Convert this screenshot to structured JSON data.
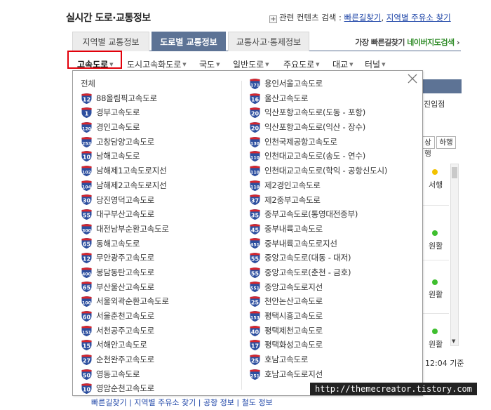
{
  "header": {
    "title": "실시간 도로·교통정보",
    "related_label": "관련 컨텐츠 검색 :",
    "related_links": [
      "빠른길찾기",
      "지역별 주유소 찾기"
    ],
    "related_sep": ","
  },
  "tabs": [
    {
      "label": "지역별 교통정보",
      "active": false
    },
    {
      "label": "도로별 교통정보",
      "active": true
    },
    {
      "label": "교통사고·통제정보",
      "active": false
    }
  ],
  "tab_right": {
    "prefix": "가장 빠른길찾기 ",
    "highlight": "네이버지도검색",
    "arrow": "›"
  },
  "subnav": [
    "고속도로",
    "도시고속화도로",
    "국도",
    "일반도로",
    "주요도로",
    "대교",
    "터널"
  ],
  "background": {
    "col_text": "진입점",
    "buttons": [
      "상행",
      "하행"
    ],
    "statuses": [
      "서행",
      "원활",
      "원활",
      "원활"
    ],
    "status_colors": [
      "#f2c200",
      "#3fbf2f",
      "#3fbf2f",
      "#3fbf2f"
    ],
    "time": "12:04 기준"
  },
  "dropdown": {
    "all_label": "전체",
    "left": [
      {
        "num": "12",
        "name": "88올림픽고속도로"
      },
      {
        "num": "1",
        "name": "경부고속도로"
      },
      {
        "num": "120",
        "name": "경인고속도로"
      },
      {
        "num": "253",
        "name": "고창담양고속도로"
      },
      {
        "num": "10",
        "name": "남해고속도로"
      },
      {
        "num": "102",
        "name": "남해제1고속도로지선"
      },
      {
        "num": "104",
        "name": "남해제2고속도로지선"
      },
      {
        "num": "30",
        "name": "당진영덕고속도로"
      },
      {
        "num": "55",
        "name": "대구부산고속도로"
      },
      {
        "num": "300",
        "name": "대전남부순환고속도로"
      },
      {
        "num": "65",
        "name": "동해고속도로"
      },
      {
        "num": "12",
        "name": "무안광주고속도로"
      },
      {
        "num": "400",
        "name": "봉담동탄고속도로"
      },
      {
        "num": "65",
        "name": "부산울산고속도로"
      },
      {
        "num": "100",
        "name": "서울외곽순환고속도로"
      },
      {
        "num": "60",
        "name": "서울춘천고속도로"
      },
      {
        "num": "151",
        "name": "서천공주고속도로"
      },
      {
        "num": "15",
        "name": "서해안고속도로"
      },
      {
        "num": "27",
        "name": "순천완주고속도로"
      },
      {
        "num": "50",
        "name": "영동고속도로"
      },
      {
        "num": "10",
        "name": "영암순천고속도로"
      }
    ],
    "right": [
      {
        "num": "171",
        "name": "용인서울고속도로"
      },
      {
        "num": "16",
        "name": "울산고속도로"
      },
      {
        "num": "20",
        "name": "익산포항고속도로(도동 - 포항)"
      },
      {
        "num": "20",
        "name": "익산포항고속도로(익산 - 장수)"
      },
      {
        "num": "130",
        "name": "인천국제공항고속도로"
      },
      {
        "num": "110",
        "name": "인천대교고속도로(송도 - 연수)"
      },
      {
        "num": "110",
        "name": "인천대교고속도로(학익 - 공항신도시)"
      },
      {
        "num": "110",
        "name": "제2경인고속도로"
      },
      {
        "num": "37",
        "name": "제2중부고속도로"
      },
      {
        "num": "35",
        "name": "중부고속도로(통영대전중부)"
      },
      {
        "num": "45",
        "name": "중부내륙고속도로"
      },
      {
        "num": "451",
        "name": "중부내륙고속도로지선"
      },
      {
        "num": "55",
        "name": "중앙고속도로(대동 - 대저)"
      },
      {
        "num": "55",
        "name": "중앙고속도로(춘천 - 금호)"
      },
      {
        "num": "551",
        "name": "중앙고속도로지선"
      },
      {
        "num": "25",
        "name": "천안논산고속도로"
      },
      {
        "num": "153",
        "name": "평택시흥고속도로"
      },
      {
        "num": "40",
        "name": "평택제천고속도로"
      },
      {
        "num": "17",
        "name": "평택화성고속도로"
      },
      {
        "num": "25",
        "name": "호남고속도로"
      },
      {
        "num": "251",
        "name": "호남고속도로지선"
      }
    ]
  },
  "watermark": "http://themecreator.tistory.com",
  "underbar": "빠른길찾기 | 지역별 주유소 찾기 | 공항 정보 | 철도 정보"
}
